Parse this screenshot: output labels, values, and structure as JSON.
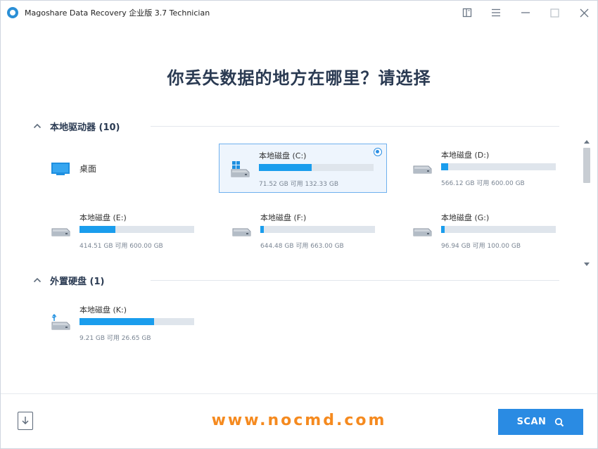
{
  "app": {
    "title": "Magoshare Data Recovery 企业版 3.7 Technician"
  },
  "page_title": "你丢失数据的地方在哪里？请选择",
  "sections": {
    "local": {
      "title": "本地驱动器 (10)"
    },
    "external": {
      "title": "外置硬盘 (1)"
    }
  },
  "desktop": {
    "label": "桌面"
  },
  "drives": [
    {
      "name": "本地磁盘 (C:)",
      "size": "71.52 GB 可用 132.33 GB",
      "used_fraction": 0.46,
      "selected": true
    },
    {
      "name": "本地磁盘 (D:)",
      "size": "566.12 GB 可用 600.00 GB",
      "used_fraction": 0.06
    },
    {
      "name": "本地磁盘 (E:)",
      "size": "414.51 GB 可用 600.00 GB",
      "used_fraction": 0.31
    },
    {
      "name": "本地磁盘 (F:)",
      "size": "644.48 GB 可用 663.00 GB",
      "used_fraction": 0.03
    },
    {
      "name": "本地磁盘 (G:)",
      "size": "96.94 GB 可用 100.00 GB",
      "used_fraction": 0.03
    }
  ],
  "external_drives": [
    {
      "name": "本地磁盘 (K:)",
      "size": "9.21 GB 可用 26.65 GB",
      "used_fraction": 0.65
    }
  ],
  "watermark": "www.nocmd.com",
  "scan_label": "SCAN",
  "colors": {
    "accent": "#2a8be3",
    "bar_fill": "#1a9ded",
    "watermark": "#f58a1f"
  }
}
